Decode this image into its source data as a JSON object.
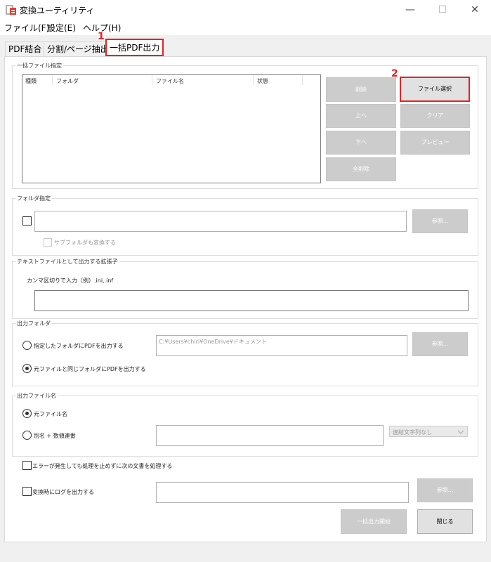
{
  "window": {
    "title": "変換ユーティリティ",
    "controls": {
      "minimize": "—",
      "maximize": "☐",
      "close": "✕"
    }
  },
  "menu": [
    "ファイル(F)",
    "設定(E)",
    "ヘルプ(H)"
  ],
  "tabs": [
    "PDF結合",
    "分割/ページ抽出",
    "一括PDF出力"
  ],
  "annotations": {
    "tab_marker": "1",
    "button_marker": "2"
  },
  "file_spec": {
    "label": "一括ファイル指定",
    "columns": [
      "種類",
      "フォルダ",
      "ファイル名",
      "状態"
    ],
    "buttons": {
      "delete": "削除",
      "select_file": "ファイル選択",
      "up": "上へ",
      "clear": "クリア",
      "down": "下へ",
      "preview": "プレビュー",
      "delete_all": "全削除"
    }
  },
  "folder_spec": {
    "label": "フォルダ指定",
    "browse": "参照...",
    "subfolder_label": "サブフォルダも変換する"
  },
  "ext_spec": {
    "label": "テキストファイルとして出力する拡張子",
    "hint": "カンマ区切りで入力（例）.ini,.inf"
  },
  "output_folder": {
    "label": "出力フォルダ",
    "option_specified": "指定したフォルダにPDFを出力する",
    "path": "C:¥Users¥chiri¥OneDrive¥ドキュメント",
    "browse": "参照...",
    "option_same": "元ファイルと同じフォルダにPDFを出力する"
  },
  "output_name": {
    "label": "出力ファイル名",
    "option_original": "元ファイル名",
    "option_alias": "別名 + 数値連番",
    "concat_select": "連結文字列なし"
  },
  "options": {
    "continue_on_error": "エラーが発生しても処理を止めずに次の文書を処理する",
    "log_output": "変換時にログを出力する",
    "browse": "参照..."
  },
  "footer": {
    "start": "一括出力開始",
    "close": "閉じる"
  }
}
